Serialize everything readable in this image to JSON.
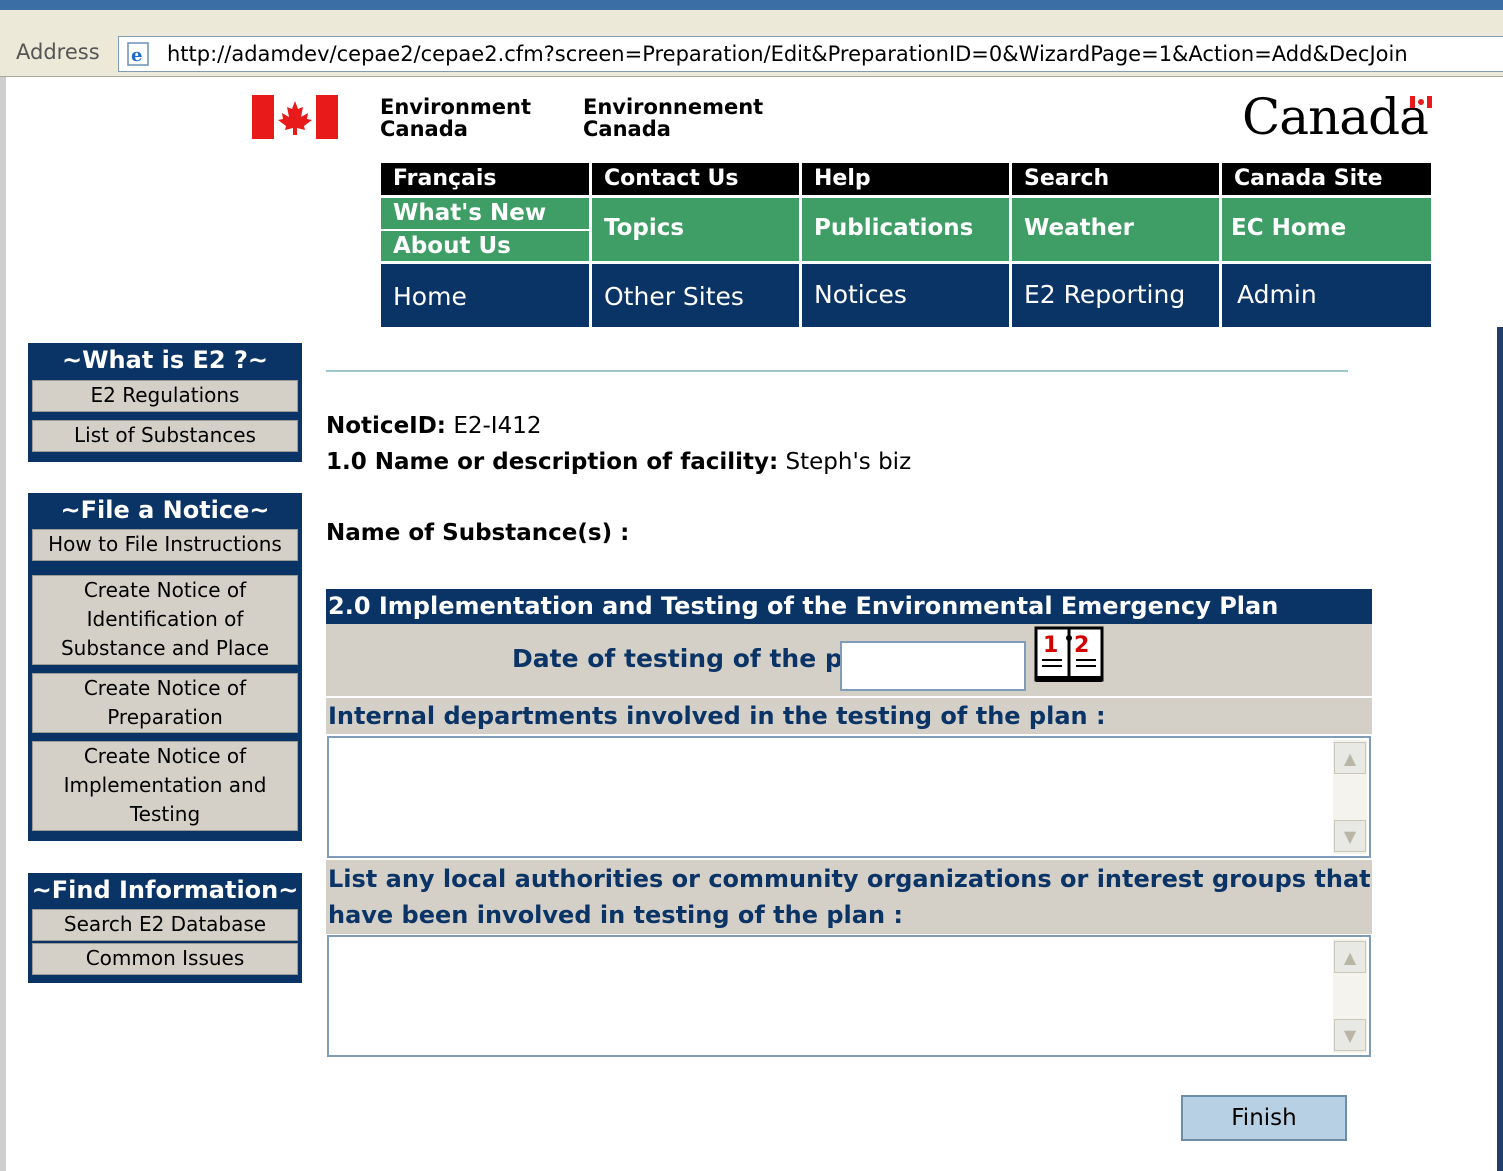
{
  "browser": {
    "address_label": "Address",
    "url": "http://adamdev/cepae2/cepae2.cfm?screen=Preparation/Edit&PreparationID=0&WizardPage=1&Action=Add&DecJoin"
  },
  "header": {
    "env_en_1": "Environment",
    "env_en_2": "Canada",
    "env_fr_1": "Environnement",
    "env_fr_2": "Canada",
    "wordmark": "Canada"
  },
  "topnav": {
    "francais": "Français",
    "contact": "Contact Us",
    "help": "Help",
    "search": "Search",
    "canada_site": "Canada Site",
    "whats_new": "What's New",
    "about_us": "About Us",
    "topics": "Topics",
    "publications": "Publications",
    "weather": "Weather",
    "ec_home": "EC Home",
    "home": "Home",
    "other_sites": "Other Sites",
    "notices": "Notices",
    "e2_reporting": "E2 Reporting",
    "admin": "Admin"
  },
  "sidebar": {
    "what_is": {
      "heading": "~What is E2 ?~",
      "items": [
        "E2 Regulations",
        "List of Substances"
      ]
    },
    "file_notice": {
      "heading": "~File a Notice~",
      "items": [
        "How to File Instructions",
        "Create Notice of Identification of Substance and Place",
        "Create Notice of Preparation",
        "Create Notice of Implementation and Testing"
      ]
    },
    "find_info": {
      "heading": "~Find Information~",
      "items": [
        "Search E2 Database",
        "Common Issues"
      ]
    }
  },
  "content": {
    "notice_label": "NoticeID:",
    "notice_value": "E2-I412",
    "facility_label": "1.0 Name or description of facility:",
    "facility_value": "Steph's biz",
    "substance_label": "Name of Substance(s) :",
    "section_title": "2.0 Implementation and Testing of the Environmental Emergency Plan",
    "date_label": "Date of testing of the plan",
    "date_value": "",
    "internal_label": "Internal departments involved in the testing of the plan :",
    "internal_value": "",
    "local_label": "List any local authorities or community organizations or interest groups that have been involved in testing of the plan :",
    "local_value": "",
    "finish_label": "Finish"
  },
  "colors": {
    "navy": "#0b3466",
    "green": "#3f9e66",
    "gray": "#d4d0c8",
    "flag_red": "#e81a1a"
  }
}
